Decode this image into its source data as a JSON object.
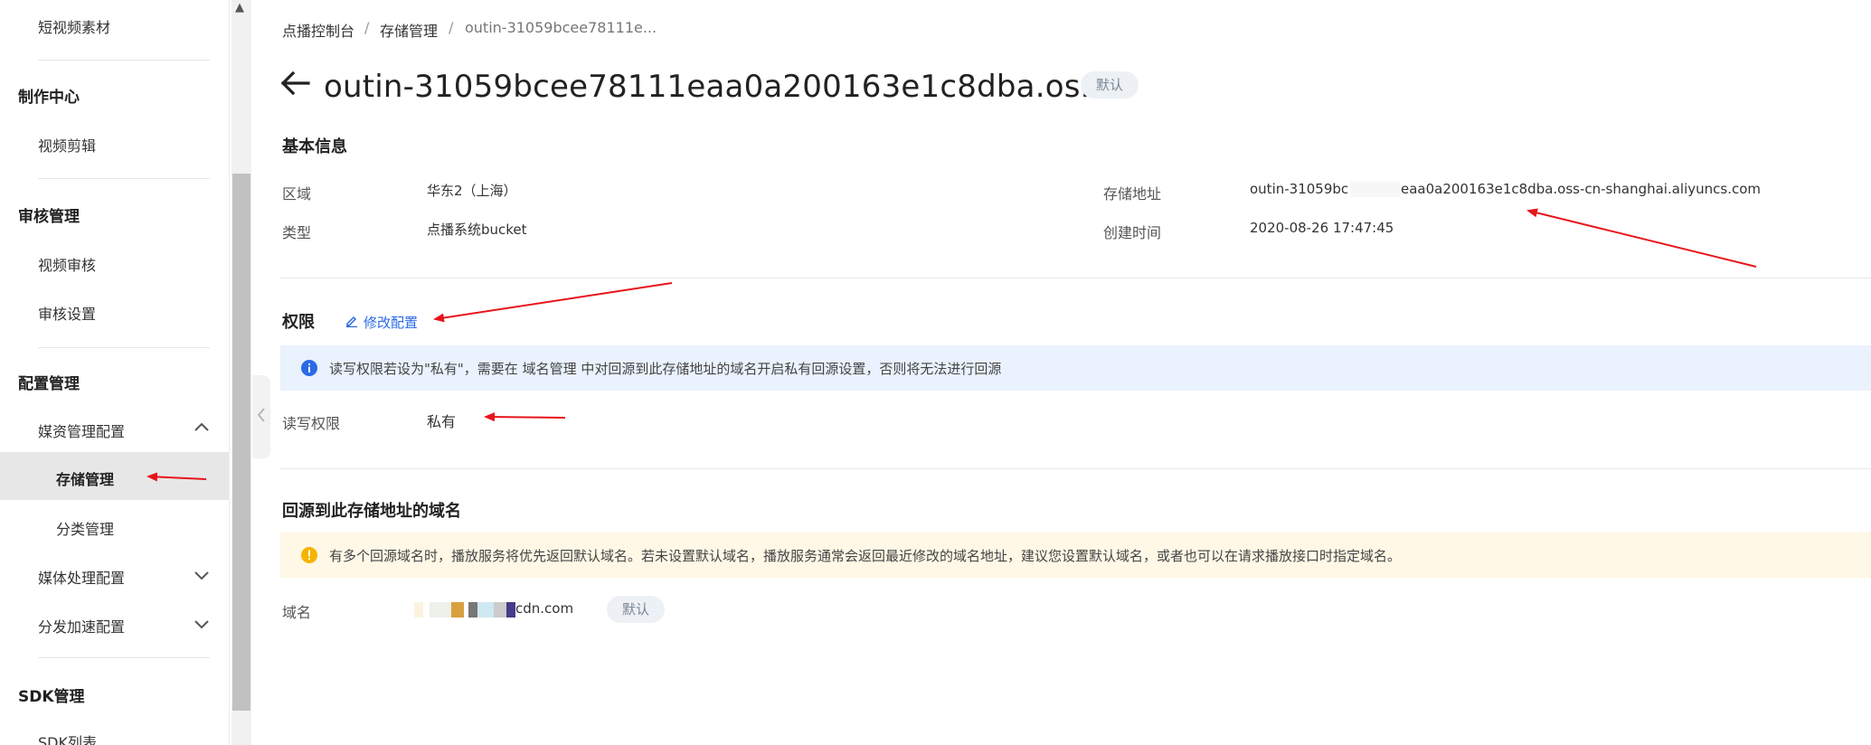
{
  "sidebar": {
    "items": [
      {
        "label": "短视频素材"
      },
      {
        "label": "制作中心"
      },
      {
        "label": "视频剪辑"
      },
      {
        "label": "审核管理"
      },
      {
        "label": "视频审核"
      },
      {
        "label": "审核设置"
      },
      {
        "label": "配置管理"
      },
      {
        "label": "媒资管理配置"
      },
      {
        "label": "存储管理"
      },
      {
        "label": "分类管理"
      },
      {
        "label": "媒体处理配置"
      },
      {
        "label": "分发加速配置"
      },
      {
        "label": "SDK管理"
      },
      {
        "label": "SDK列表"
      }
    ]
  },
  "breadcrumb": {
    "items": [
      "点播控制台",
      "存储管理",
      "outin-31059bcee78111e..."
    ],
    "separator": "/"
  },
  "header": {
    "title": "outin-31059bcee78111eaa0a200163e1c8dba.os...",
    "badge": "默认"
  },
  "basic_info": {
    "title": "基本信息",
    "region_label": "区域",
    "region_value": "华东2（上海）",
    "type_label": "类型",
    "type_value": "点播系统bucket",
    "address_label": "存储地址",
    "address_value_prefix": "outin-31059bc",
    "address_value_suffix": "eaa0a200163e1c8dba.oss-cn-shanghai.aliyuncs.com",
    "created_label": "创建时间",
    "created_value": "2020-08-26 17:47:45"
  },
  "permissions": {
    "title": "权限",
    "edit_label": "修改配置",
    "notice": "读写权限若设为\"私有\"，需要在 域名管理 中对回源到此存储地址的域名开启私有回源设置，否则将无法进行回源",
    "rw_label": "读写权限",
    "rw_value": "私有"
  },
  "domains": {
    "title": "回源到此存储地址的域名",
    "notice": "有多个回源域名时，播放服务将优先返回默认域名。若未设置默认域名，播放服务通常会返回最近修改的域名地址，建议您设置默认域名，或者也可以在请求播放接口时指定域名。",
    "domain_label": "域名",
    "domain_value_suffix": "cdn.com",
    "default_badge": "默认"
  },
  "colors": {
    "link": "#2a6ae5",
    "annotation_arrow": "#e8141b",
    "info_bg": "#e9f2fd",
    "warn_bg": "#fff8e6",
    "info_icon": "#2a6ae5",
    "warn_icon": "#f5b400"
  },
  "icons": [
    "back-arrow-icon",
    "chevron-up-icon",
    "chevron-down-icon",
    "chevron-left-icon",
    "edit-icon",
    "info-icon",
    "warning-icon"
  ]
}
